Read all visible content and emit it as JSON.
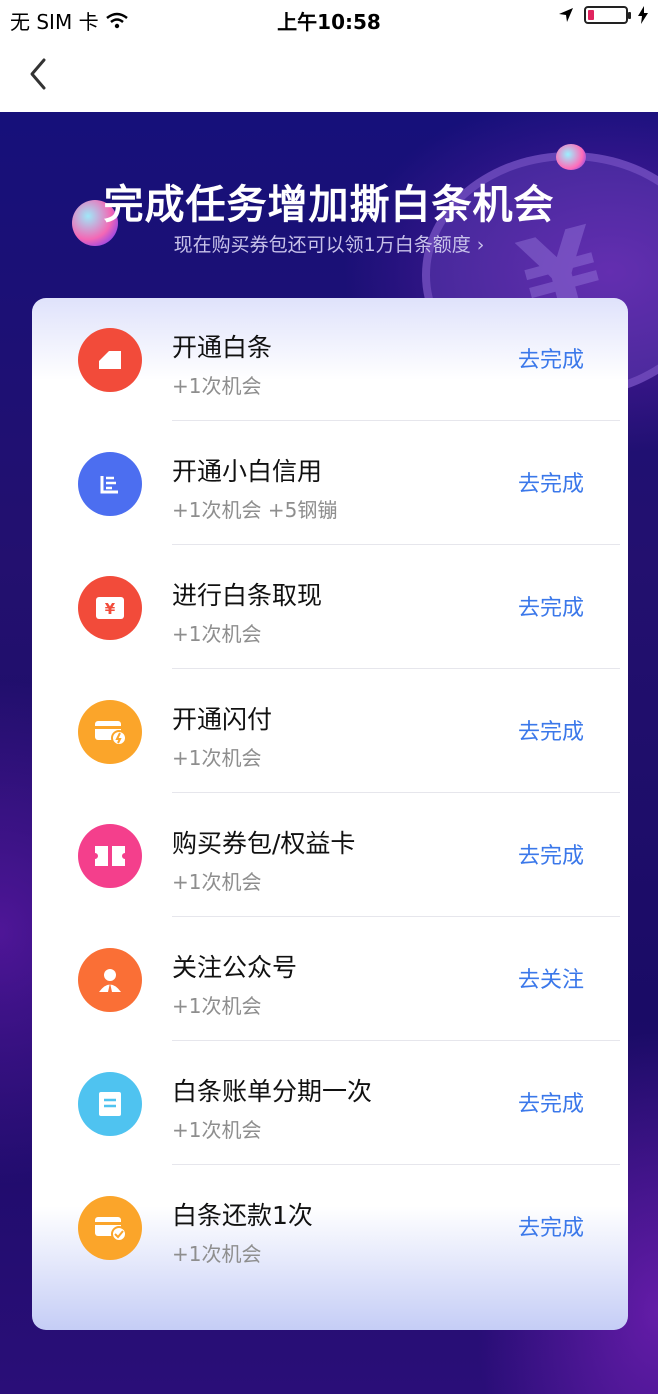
{
  "status_bar": {
    "carrier": "无 SIM 卡",
    "time": "上午10:58"
  },
  "header": {
    "title": "完成任务增加撕白条机会",
    "subtitle": "现在购买券包还可以领1万白条额度 ›"
  },
  "tasks": [
    {
      "title": "开通白条",
      "reward": "+1次机会",
      "action": "去完成",
      "icon": "baitiao-icon",
      "color": "#f24b3a"
    },
    {
      "title": "开通小白信用",
      "reward": "+1次机会 +5钢镚",
      "action": "去完成",
      "icon": "credit-icon",
      "color": "#4c6ef0"
    },
    {
      "title": "进行白条取现",
      "reward": "+1次机会",
      "action": "去完成",
      "icon": "cash-icon",
      "color": "#f24b3a"
    },
    {
      "title": "开通闪付",
      "reward": "+1次机会",
      "action": "去完成",
      "icon": "flash-pay-icon",
      "color": "#fba52a"
    },
    {
      "title": "购买券包/权益卡",
      "reward": "+1次机会",
      "action": "去完成",
      "icon": "coupon-icon",
      "color": "#f43f8c"
    },
    {
      "title": "关注公众号",
      "reward": "+1次机会",
      "action": "去关注",
      "icon": "person-icon",
      "color": "#fa6f36"
    },
    {
      "title": "白条账单分期一次",
      "reward": "+1次机会",
      "action": "去完成",
      "icon": "bill-icon",
      "color": "#4fc3f0"
    },
    {
      "title": "白条还款1次",
      "reward": "+1次机会",
      "action": "去完成",
      "icon": "repay-icon",
      "color": "#fba52a"
    }
  ]
}
